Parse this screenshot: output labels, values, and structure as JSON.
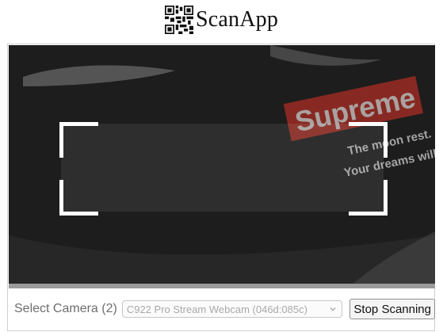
{
  "header": {
    "logo_icon": "qr-code-icon",
    "title": "ScanApp"
  },
  "scanner": {
    "camera_feed_icon": "camera-feed",
    "viewfinder_box": "scan-region",
    "feed_text": {
      "brand": "Supreme",
      "line1": "The moon rest.",
      "line2": "Your dreams will c"
    }
  },
  "controls": {
    "select_camera_label": "Select Camera (2)",
    "selected_camera": "C922 Pro Stream Webcam (046d:085c)",
    "stop_button_label": "Stop Scanning"
  },
  "colors": {
    "viewfinder_corners": "#ffffff",
    "brand_box": "#c23b32",
    "panel_border": "#cfcfcf"
  }
}
